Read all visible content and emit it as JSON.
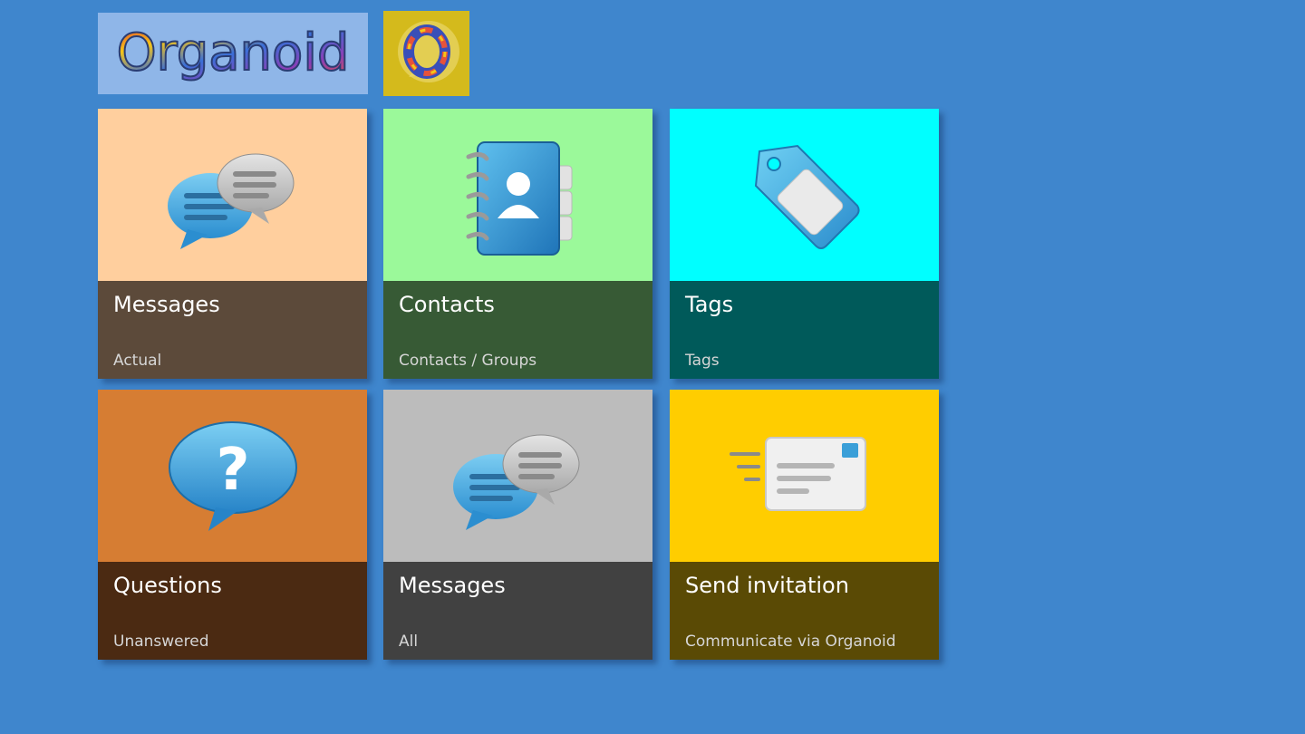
{
  "app": {
    "logo_text": "Organoid",
    "logo_icon": "organoid-o-logo-icon"
  },
  "tiles": [
    {
      "title": "Messages",
      "subtitle": "Actual",
      "icon": "chat-bubbles-icon",
      "top_color": "#ffcf9e",
      "bottom_color": "#5c4a3a"
    },
    {
      "title": "Contacts",
      "subtitle": "Contacts / Groups",
      "icon": "address-book-icon",
      "top_color": "#9bf99a",
      "bottom_color": "#375a35"
    },
    {
      "title": "Tags",
      "subtitle": "Tags",
      "icon": "tag-icon",
      "top_color": "#00ffff",
      "bottom_color": "#005a5a"
    },
    {
      "title": "Questions",
      "subtitle": "Unanswered",
      "icon": "question-bubble-icon",
      "top_color": "#d67d33",
      "bottom_color": "#4b2a12"
    },
    {
      "title": "Messages",
      "subtitle": "All",
      "icon": "chat-bubbles-icon",
      "top_color": "#bcbcbc",
      "bottom_color": "#414141"
    },
    {
      "title": "Send invitation",
      "subtitle": "Communicate via Organoid",
      "icon": "send-mail-icon",
      "top_color": "#ffcd00",
      "bottom_color": "#5a4a05"
    }
  ]
}
